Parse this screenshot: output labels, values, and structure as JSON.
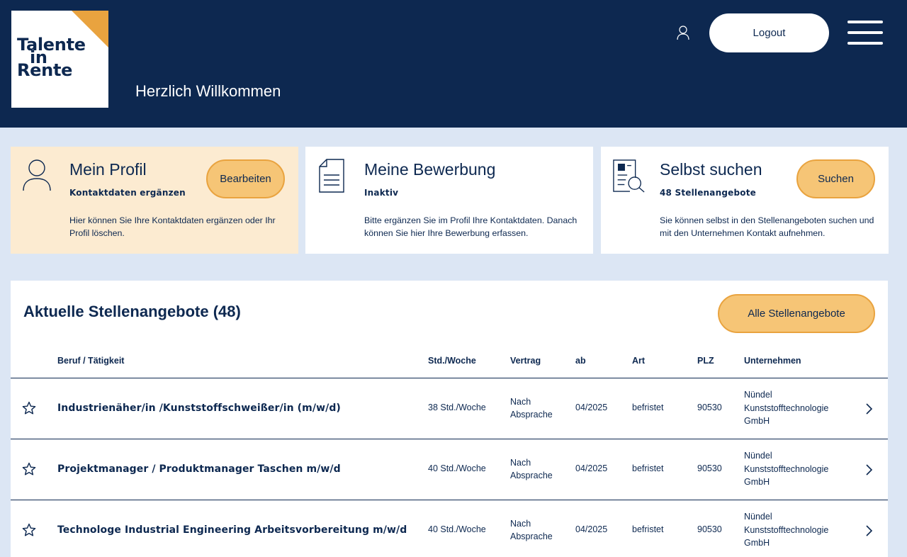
{
  "header": {
    "logo": {
      "line1": "Talente",
      "line2": "in",
      "line3": "Rente"
    },
    "welcome": "Herzlich Willkommen",
    "logout_label": "Logout",
    "icons": {
      "user": "user-icon",
      "menu": "hamburger-menu-icon"
    }
  },
  "cards": [
    {
      "title": "Mein Profil",
      "subtitle": "Kontaktdaten ergänzen",
      "description": "Hier können Sie Ihre Kontaktdaten ergänzen oder Ihr Profil löschen.",
      "button": "Bearbeiten",
      "icon": "profile-icon"
    },
    {
      "title": "Meine Bewerbung",
      "subtitle": "Inaktiv",
      "description": "Bitte ergänzen Sie im Profil Ihre Kontaktdaten. Danach können Sie hier Ihre Bewerbung erfassen.",
      "icon": "document-icon"
    },
    {
      "title": "Selbst suchen",
      "subtitle": "48 Stellenangebote",
      "description": "Sie können selbst in den Stellenangeboten suchen und mit den Unternehmen Kontakt aufnehmen.",
      "button": "Suchen",
      "icon": "document-search-icon"
    }
  ],
  "jobs": {
    "title": "Aktuelle Stellenangebote (48)",
    "all_button": "Alle Stellenangebote",
    "columns": [
      "Beruf / Tätigkeit",
      "Std./Woche",
      "Vertrag",
      "ab",
      "Art",
      "PLZ",
      "Unternehmen"
    ],
    "rows": [
      {
        "beruf": "Industrienäher/in /Kunststoffschweißer/in (m/w/d)",
        "std": "38 Std./Woche",
        "vertrag": "Nach Absprache",
        "ab": "04/2025",
        "art": "befristet",
        "plz": "90530",
        "unternehmen": "Nündel Kunststofftechnologie GmbH"
      },
      {
        "beruf": "Projektmanager / Produktmanager Taschen m/w/d",
        "std": "40 Std./Woche",
        "vertrag": "Nach Absprache",
        "ab": "04/2025",
        "art": "befristet",
        "plz": "90530",
        "unternehmen": "Nündel Kunststofftechnologie GmbH"
      },
      {
        "beruf": "Technologe Industrial Engineering Arbeitsvorbereitung m/w/d",
        "std": "40 Std./Woche",
        "vertrag": "Nach Absprache",
        "ab": "04/2025",
        "art": "befristet",
        "plz": "90530",
        "unternehmen": "Nündel Kunststofftechnologie GmbH"
      }
    ]
  },
  "colors": {
    "navy": "#0d2850",
    "background": "#dce6f4",
    "accent_orange": "#e9a33f",
    "button_fill": "#f6c576",
    "profile_card": "#fcebd1"
  }
}
